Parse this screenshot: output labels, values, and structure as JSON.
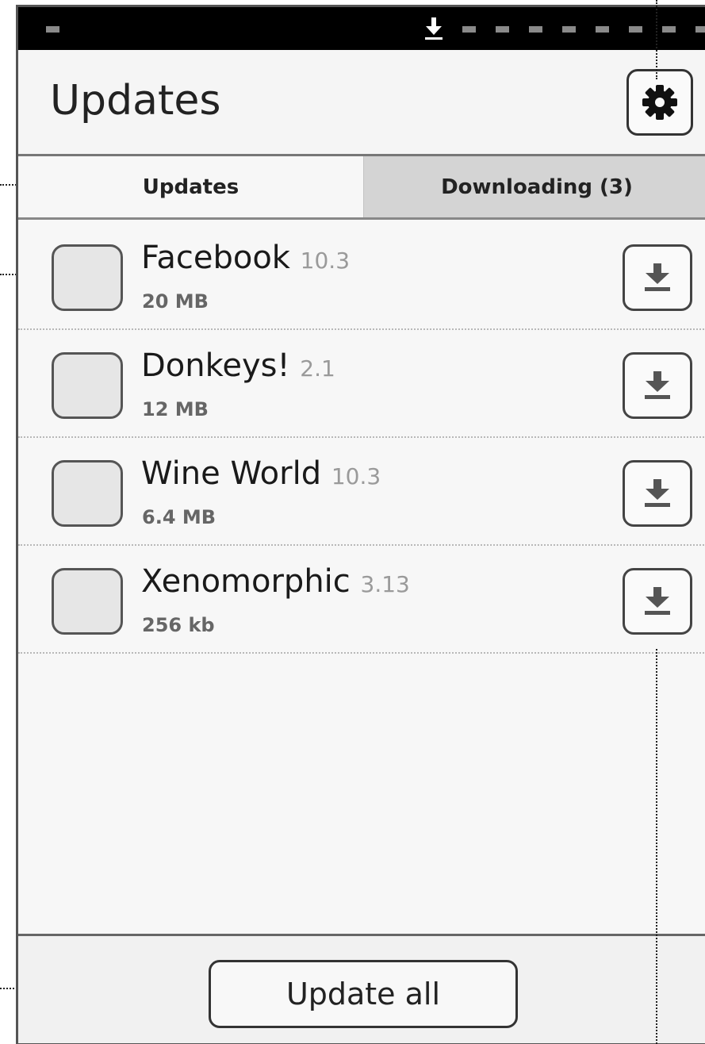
{
  "title_bar": {
    "title": "Updates",
    "settings_icon": "gear-icon"
  },
  "tabs": [
    {
      "label": "Updates",
      "selected": true
    },
    {
      "label": "Downloading (3)",
      "selected": false
    }
  ],
  "apps": [
    {
      "name": "Facebook",
      "version": "10.3",
      "size": "20 MB"
    },
    {
      "name": "Donkeys!",
      "version": "2.1",
      "size": "12 MB"
    },
    {
      "name": "Wine World",
      "version": "10.3",
      "size": "6.4 MB"
    },
    {
      "name": "Xenomorphic",
      "version": "3.13",
      "size": "256 kb"
    }
  ],
  "footer": {
    "update_all_label": "Update all"
  },
  "colors": {
    "status_bar": "#000000",
    "selected_tab": "#f7f7f7",
    "unselected_tab": "#d4d4d4"
  }
}
